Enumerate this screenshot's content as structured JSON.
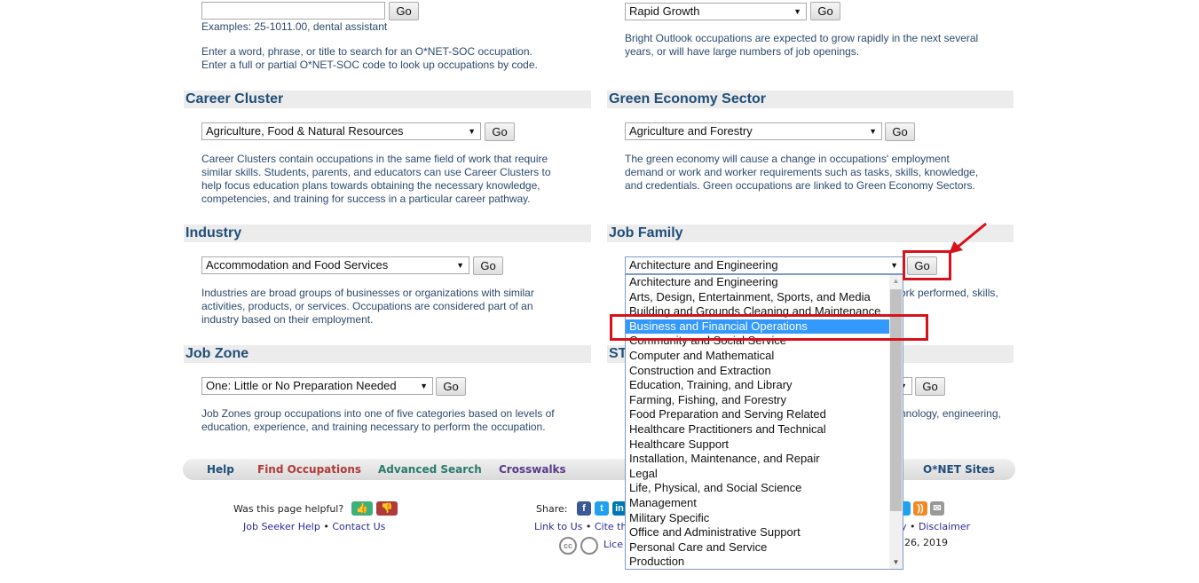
{
  "keyword": {
    "value": "",
    "go": "Go",
    "examples": "Examples: 25-1011.00, dental assistant",
    "desc1": "Enter a word, phrase, or title to search for an O*NET-SOC occupation.",
    "desc2": "Enter a full or partial O*NET-SOC code to look up occupations by code."
  },
  "bright": {
    "selected": "Rapid Growth",
    "go": "Go",
    "desc1": "Bright Outlook occupations are expected to grow rapidly in the next several",
    "desc2": "years, or will have large numbers of job openings."
  },
  "career": {
    "title": "Career Cluster",
    "selected": "Agriculture, Food & Natural Resources",
    "go": "Go",
    "lines": [
      "Career Clusters contain occupations in the same field of work that require",
      "similar skills. Students, parents, and educators can use Career Clusters to",
      "help focus education plans towards obtaining the necessary knowledge,",
      "competencies, and training for success in a particular career pathway."
    ]
  },
  "green": {
    "title": "Green Economy Sector",
    "selected": "Agriculture and Forestry",
    "go": "Go",
    "lines": [
      "The green economy will cause a change in occupations' employment",
      "demand or work and worker requirements such as tasks, skills, knowledge,",
      "and credentials. Green occupations are linked to Green Economy Sectors."
    ]
  },
  "industry": {
    "title": "Industry",
    "selected": "Accommodation and Food Services",
    "go": "Go",
    "lines": [
      "Industries are broad groups of businesses or organizations with similar",
      "activities, products, or services. Occupations are considered part of an",
      "industry based on their employment."
    ]
  },
  "jobfamily": {
    "title": "Job Family",
    "selected": "Architecture and Engineering",
    "go": "Go",
    "desc_visible": "ork performed, skills,",
    "options": [
      "Architecture and Engineering",
      "Arts, Design, Entertainment, Sports, and Media",
      "Building and Grounds Cleaning and Maintenance",
      "Business and Financial Operations",
      "Community and Social Service",
      "Computer and Mathematical",
      "Construction and Extraction",
      "Education, Training, and Library",
      "Farming, Fishing, and Forestry",
      "Food Preparation and Serving Related",
      "Healthcare Practitioners and Technical",
      "Healthcare Support",
      "Installation, Maintenance, and Repair",
      "Legal",
      "Life, Physical, and Social Science",
      "Management",
      "Military Specific",
      "Office and Administrative Support",
      "Personal Care and Service",
      "Production"
    ],
    "highlighted": "Business and Financial Operations"
  },
  "jobzone": {
    "title": "Job Zone",
    "selected": "One: Little or No Preparation Needed",
    "go": "Go",
    "lines": [
      "Job Zones group occupations into one of five categories based on levels of",
      "education, experience, and training necessary to perform the occupation."
    ]
  },
  "stem": {
    "title": "ST",
    "go": "Go",
    "desc_visible": "hnology, engineering,"
  },
  "nav": {
    "help": "Help",
    "find": "Find Occupations",
    "advanced": "Advanced Search",
    "crosswalks": "Crosswalks",
    "sites": "O*NET Sites"
  },
  "footer": {
    "helpful": "Was this page helpful?",
    "jobseeker": "Job Seeker Help",
    "contact": "Contact Us",
    "share": "Share:",
    "link": "Link to Us",
    "cite": "Cite th",
    "license": "Lice",
    "privacy": "y",
    "disclaimer": "Disclaimer",
    "date": "26, 2019"
  },
  "colors": {
    "heading": "#1f4e79",
    "highlight": "#3399ff",
    "annotation": "#d8121a"
  }
}
